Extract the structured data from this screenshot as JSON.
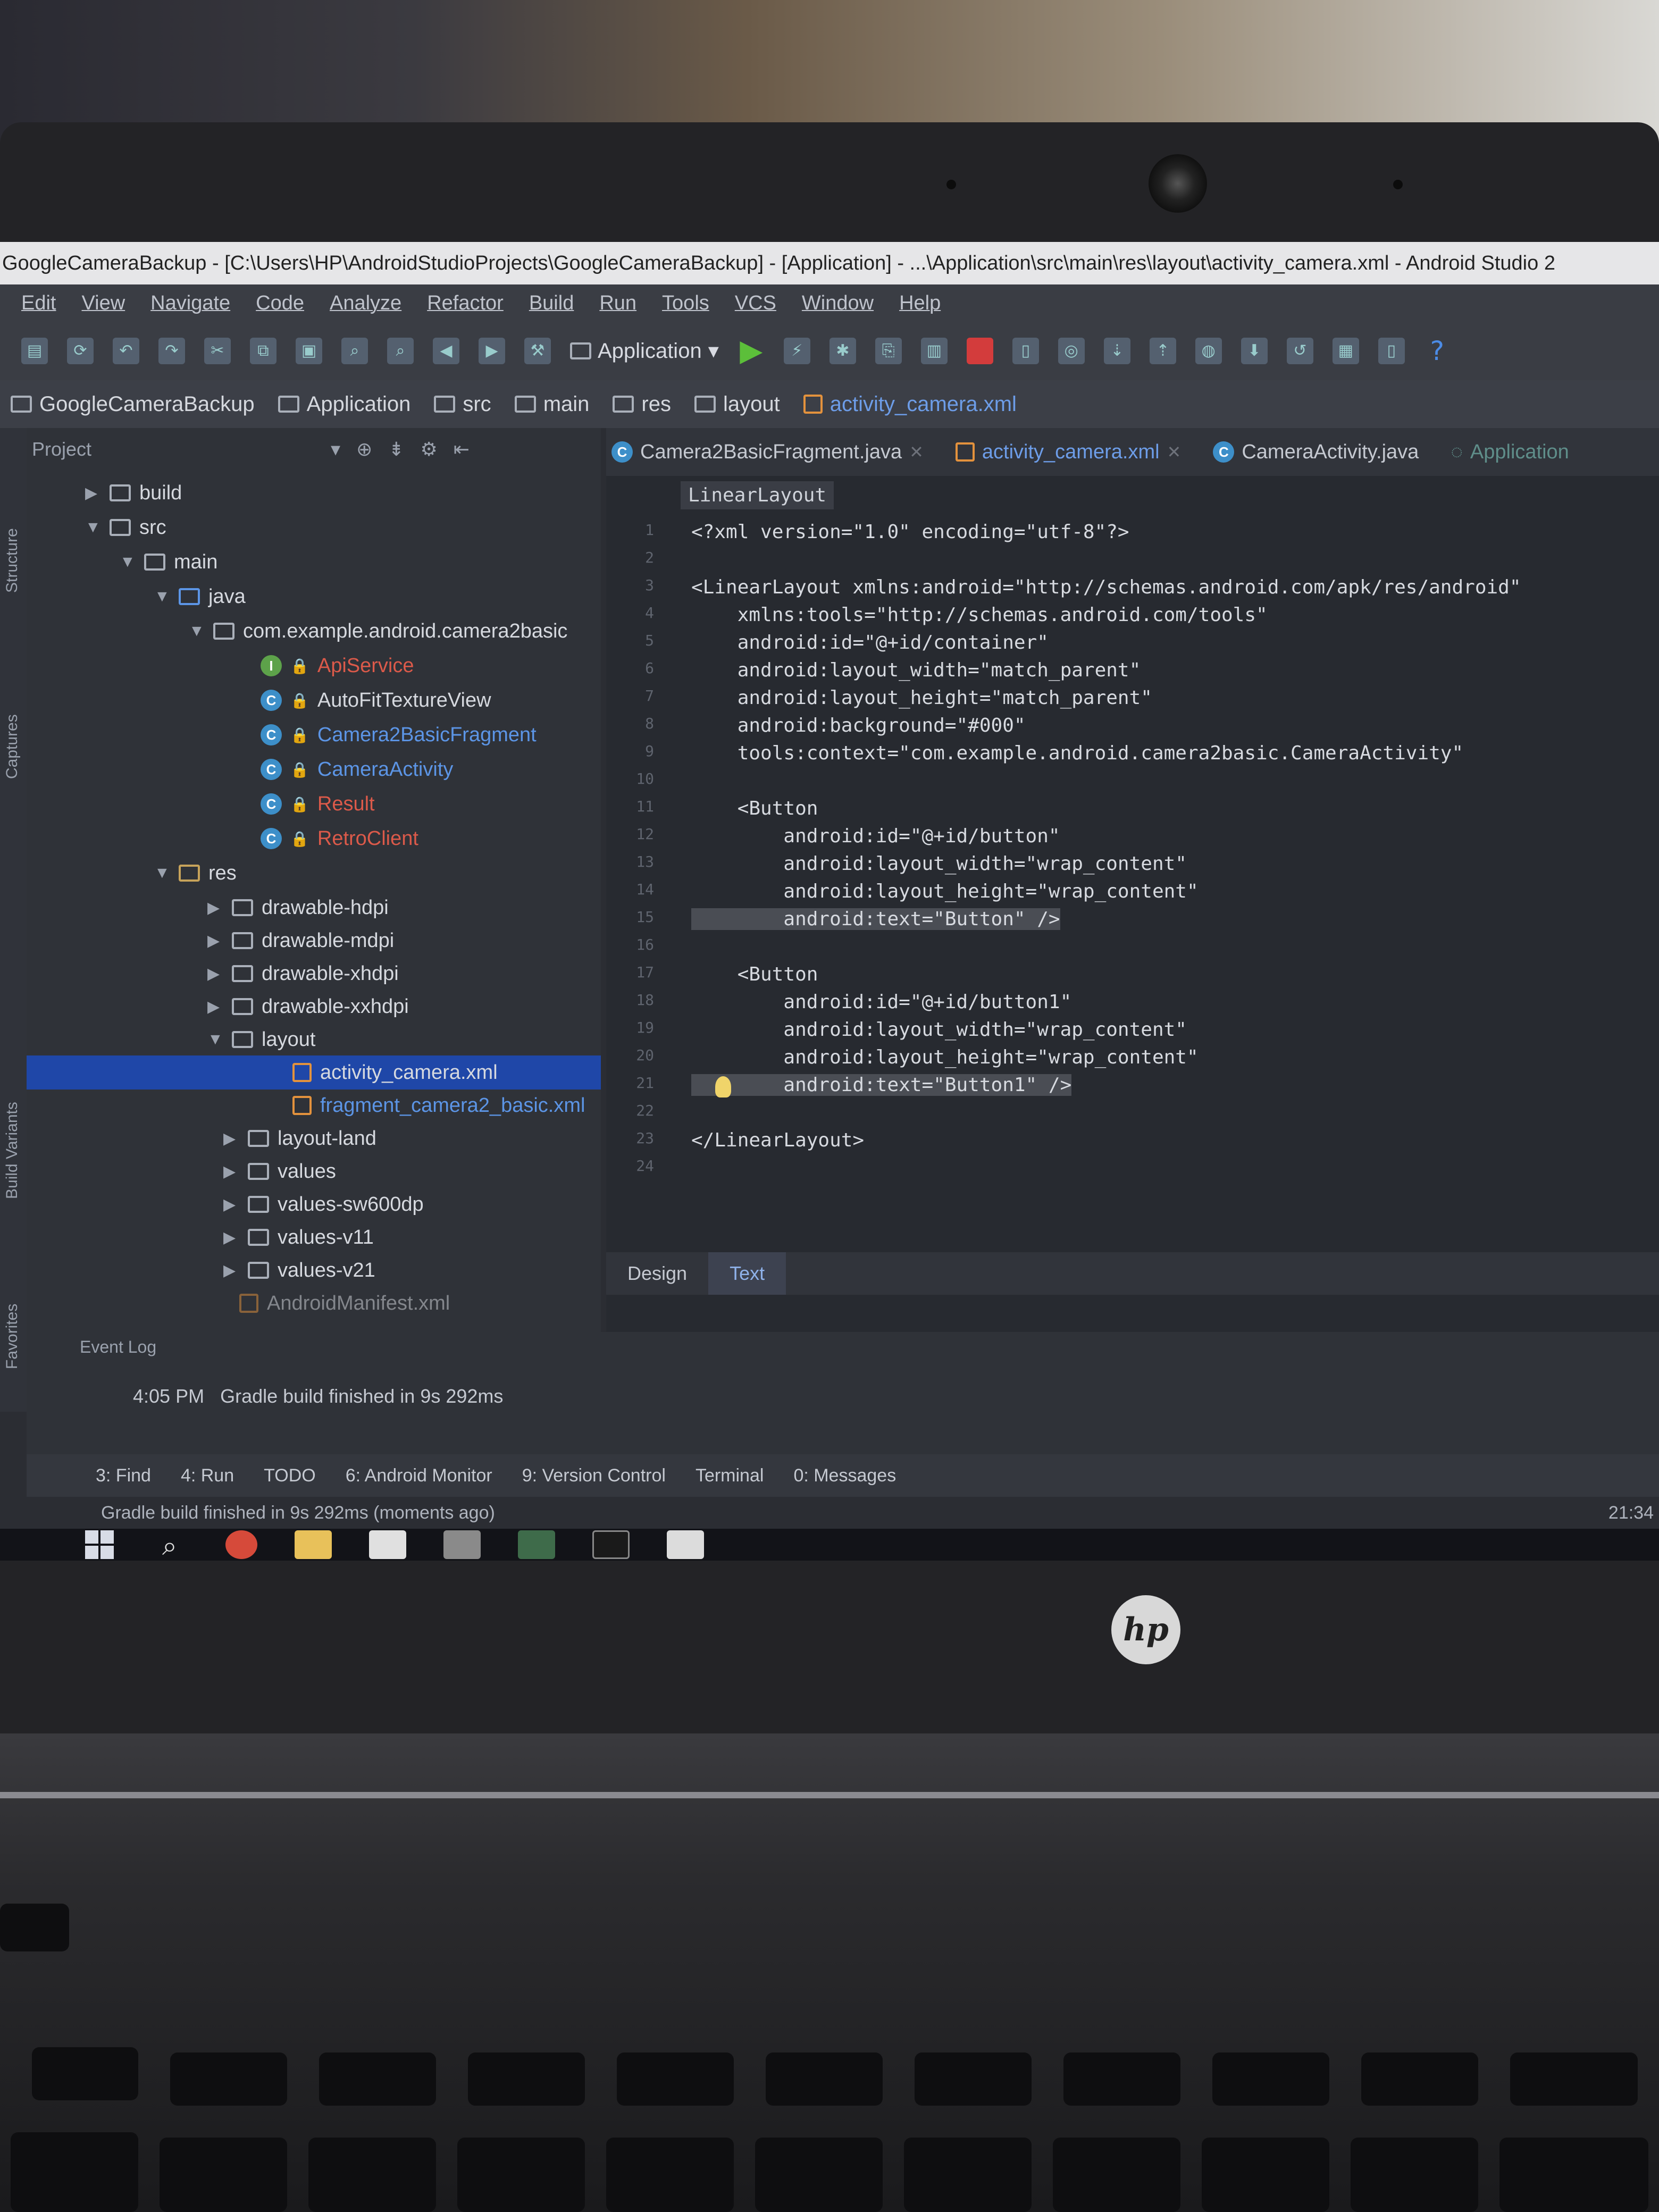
{
  "window": {
    "title": "GoogleCameraBackup - [C:\\Users\\HP\\AndroidStudioProjects\\GoogleCameraBackup] - [Application] - ...\\Application\\src\\main\\res\\layout\\activity_camera.xml - Android Studio 2"
  },
  "menu": [
    "Edit",
    "View",
    "Navigate",
    "Code",
    "Analyze",
    "Refactor",
    "Build",
    "Run",
    "Tools",
    "VCS",
    "Window",
    "Help"
  ],
  "toolbar": {
    "run_config": "Application"
  },
  "breadcrumb": [
    "GoogleCameraBackup",
    "Application",
    "src",
    "main",
    "res",
    "layout",
    "activity_camera.xml"
  ],
  "project_panel": {
    "title": "Project",
    "tree": [
      {
        "label": "build"
      },
      {
        "label": "src"
      },
      {
        "label": "main"
      },
      {
        "label": "java"
      },
      {
        "label": "com.example.android.camera2basic"
      },
      {
        "label": "ApiService"
      },
      {
        "label": "AutoFitTextureView"
      },
      {
        "label": "Camera2BasicFragment"
      },
      {
        "label": "CameraActivity"
      },
      {
        "label": "Result"
      },
      {
        "label": "RetroClient"
      },
      {
        "label": "res"
      },
      {
        "label": "drawable-hdpi"
      },
      {
        "label": "drawable-mdpi"
      },
      {
        "label": "drawable-xhdpi"
      },
      {
        "label": "drawable-xxhdpi"
      },
      {
        "label": "layout"
      },
      {
        "label": "activity_camera.xml"
      },
      {
        "label": "fragment_camera2_basic.xml"
      },
      {
        "label": "layout-land"
      },
      {
        "label": "values"
      },
      {
        "label": "values-sw600dp"
      },
      {
        "label": "values-v11"
      },
      {
        "label": "values-v21"
      },
      {
        "label": "AndroidManifest.xml"
      }
    ]
  },
  "editor": {
    "tabs": [
      "Camera2BasicFragment.java",
      "activity_camera.xml",
      "CameraActivity.java",
      "Application"
    ],
    "breadcrumb_tag": "LinearLayout",
    "line_numbers": [
      "1",
      "2",
      "3",
      "4",
      "5",
      "6",
      "7",
      "8",
      "9",
      "10",
      "11",
      "12",
      "13",
      "14",
      "15",
      "16",
      "17",
      "18",
      "19",
      "20",
      "21",
      "22",
      "23",
      "24"
    ],
    "lines": [
      "<?xml version=\"1.0\" encoding=\"utf-8\"?>",
      "",
      "<LinearLayout xmlns:android=\"http://schemas.android.com/apk/res/android\"",
      "    xmlns:tools=\"http://schemas.android.com/tools\"",
      "    android:id=\"@+id/container\"",
      "    android:layout_width=\"match_parent\"",
      "    android:layout_height=\"match_parent\"",
      "    android:background=\"#000\"",
      "    tools:context=\"com.example.android.camera2basic.CameraActivity\"",
      "",
      "    <Button",
      "        android:id=\"@+id/button\"",
      "        android:layout_width=\"wrap_content\"",
      "        android:layout_height=\"wrap_content\"",
      "        android:text=\"Button\" />",
      "",
      "    <Button",
      "        android:id=\"@+id/button1\"",
      "        android:layout_width=\"wrap_content\"",
      "        android:layout_height=\"wrap_content\"",
      "        android:text=\"Button1\" />",
      "",
      "</LinearLayout>",
      ""
    ],
    "bottom_tabs": [
      "Design",
      "Text"
    ]
  },
  "event_log": {
    "title": "Event Log",
    "time": "4:05 PM",
    "message": "Gradle build finished in 9s 292ms"
  },
  "tool_tabs": [
    "3: Find",
    "4: Run",
    "TODO",
    "6: Android Monitor",
    "9: Version Control",
    "Terminal",
    "0: Messages"
  ],
  "side_stripe": [
    "Structure",
    "Captures",
    "Build Variants",
    "Favorites"
  ],
  "status": {
    "message": "Gradle build finished in 9s 292ms (moments ago)",
    "position": "21:34"
  },
  "hardware": {
    "brand": "hp"
  }
}
